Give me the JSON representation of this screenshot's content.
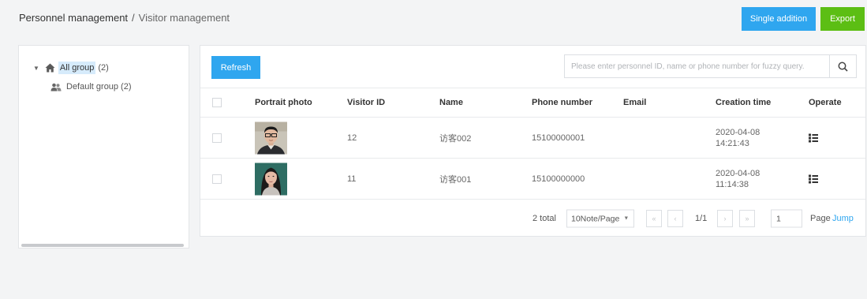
{
  "breadcrumb": {
    "parent": "Personnel management",
    "separator": "/",
    "current": "Visitor management"
  },
  "header_actions": {
    "single_addition": "Single addition",
    "export": "Export"
  },
  "tree": {
    "root": {
      "label": "All group",
      "count": "(2)"
    },
    "children": [
      {
        "label": "Default group",
        "count": "(2)"
      }
    ]
  },
  "toolbar": {
    "refresh": "Refresh",
    "search_placeholder": "Please enter personnel ID, name or phone number for fuzzy query."
  },
  "table": {
    "headers": {
      "portrait": "Portrait photo",
      "visitor_id": "Visitor ID",
      "name": "Name",
      "phone": "Phone number",
      "email": "Email",
      "creation_time": "Creation time",
      "operate": "Operate"
    },
    "rows": [
      {
        "visitor_id": "12",
        "name": "访客002",
        "phone": "15100000001",
        "email": "",
        "date": "2020-04-08",
        "time": "14:21:43"
      },
      {
        "visitor_id": "11",
        "name": "访客001",
        "phone": "15100000000",
        "email": "",
        "date": "2020-04-08",
        "time": "11:14:38"
      }
    ]
  },
  "pagination": {
    "total": "2 total",
    "page_size": "10Note/Page",
    "first": "«",
    "prev": "‹",
    "page_info": "1/1",
    "next": "›",
    "last": "»",
    "jump_value": "1",
    "page_label": "Page",
    "jump_label": "Jump"
  },
  "colors": {
    "primary": "#2fa6ef",
    "export": "#5cbe14",
    "tree_selected": "#d6ebfb",
    "link": "#2fa6ef"
  },
  "icons": [
    "home-icon",
    "group-icon",
    "search-icon",
    "operate-list-icon",
    "caret-down-icon"
  ]
}
